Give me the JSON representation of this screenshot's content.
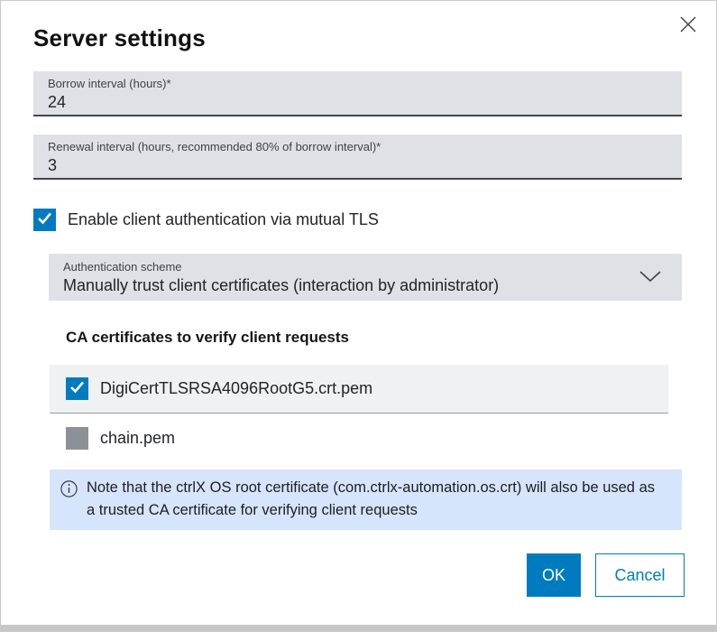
{
  "dialog": {
    "title": "Server settings"
  },
  "fields": {
    "borrow": {
      "label": "Borrow interval (hours)*",
      "value": "24"
    },
    "renewal": {
      "label": "Renewal interval (hours, recommended 80% of borrow interval)*",
      "value": "3"
    }
  },
  "mtls": {
    "label": "Enable client authentication via mutual TLS",
    "checked": true
  },
  "auth_scheme": {
    "label": "Authentication scheme",
    "value": "Manually trust client certificates (interaction by administrator)"
  },
  "ca_section": {
    "heading": "CA certificates to verify client requests",
    "items": [
      {
        "name": "DigiCertTLSRSA4096RootG5.crt.pem",
        "checked": true
      },
      {
        "name": "chain.pem",
        "checked": false
      }
    ]
  },
  "note": {
    "text": "Note that the ctrlX OS root certificate (com.ctrlx-automation.os.crt) will also be used as a trusted CA certificate for verifying client requests"
  },
  "buttons": {
    "ok": "OK",
    "cancel": "Cancel"
  },
  "colors": {
    "accent_blue": "#007bc0",
    "input_background": "#e0e1e6",
    "list_row_background": "#eff1f2",
    "note_background": "#d6e4fc",
    "unchecked_gray": "#8b9197"
  }
}
